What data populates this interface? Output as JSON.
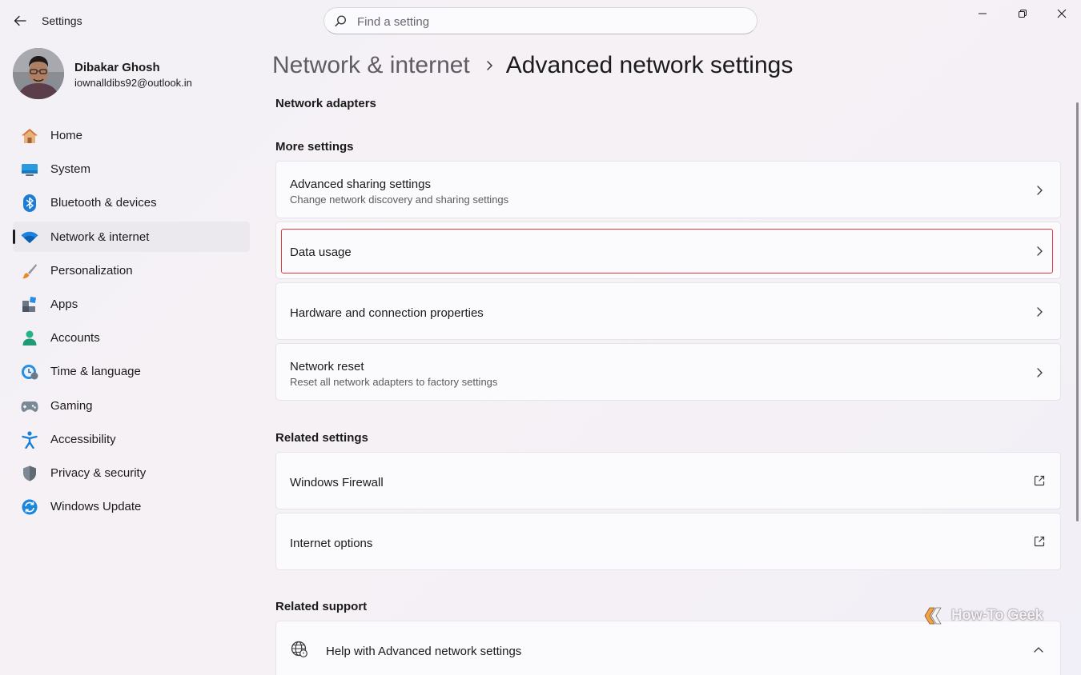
{
  "window": {
    "app_title": "Settings",
    "search_placeholder": "Find a setting"
  },
  "profile": {
    "name": "Dibakar Ghosh",
    "email": "iownalldibs92@outlook.in"
  },
  "sidebar": {
    "items": [
      {
        "label": "Home",
        "icon": "home-icon",
        "active": false
      },
      {
        "label": "System",
        "icon": "system-icon",
        "active": false
      },
      {
        "label": "Bluetooth & devices",
        "icon": "bluetooth-icon",
        "active": false
      },
      {
        "label": "Network & internet",
        "icon": "wifi-icon",
        "active": true
      },
      {
        "label": "Personalization",
        "icon": "brush-icon",
        "active": false
      },
      {
        "label": "Apps",
        "icon": "apps-icon",
        "active": false
      },
      {
        "label": "Accounts",
        "icon": "accounts-icon",
        "active": false
      },
      {
        "label": "Time & language",
        "icon": "time-language-icon",
        "active": false
      },
      {
        "label": "Gaming",
        "icon": "gamepad-icon",
        "active": false
      },
      {
        "label": "Accessibility",
        "icon": "accessibility-icon",
        "active": false
      },
      {
        "label": "Privacy & security",
        "icon": "shield-icon",
        "active": false
      },
      {
        "label": "Windows Update",
        "icon": "update-icon",
        "active": false
      }
    ]
  },
  "breadcrumb": {
    "parent": "Network & internet",
    "current": "Advanced network settings"
  },
  "sections": {
    "network_adapters": "Network adapters",
    "more_settings": "More settings",
    "related_settings": "Related settings",
    "related_support": "Related support"
  },
  "more_settings": [
    {
      "title": "Advanced sharing settings",
      "subtitle": "Change network discovery and sharing settings"
    },
    {
      "title": "Data usage",
      "subtitle": "",
      "highlighted": true
    },
    {
      "title": "Hardware and connection properties",
      "subtitle": ""
    },
    {
      "title": "Network reset",
      "subtitle": "Reset all network adapters to factory settings"
    }
  ],
  "related_settings": [
    {
      "title": "Windows Firewall",
      "icon": "external-link-icon"
    },
    {
      "title": "Internet options",
      "icon": "external-link-icon"
    }
  ],
  "related_support": [
    {
      "title": "Help with Advanced network settings",
      "icon": "globe-help-icon",
      "expanded": true
    }
  ],
  "watermark": "How-To Geek",
  "colors": {
    "accent": "#0067c0",
    "highlight_border": "#e0383e",
    "background": "#f3f1f6",
    "card": "#fbfafc"
  }
}
